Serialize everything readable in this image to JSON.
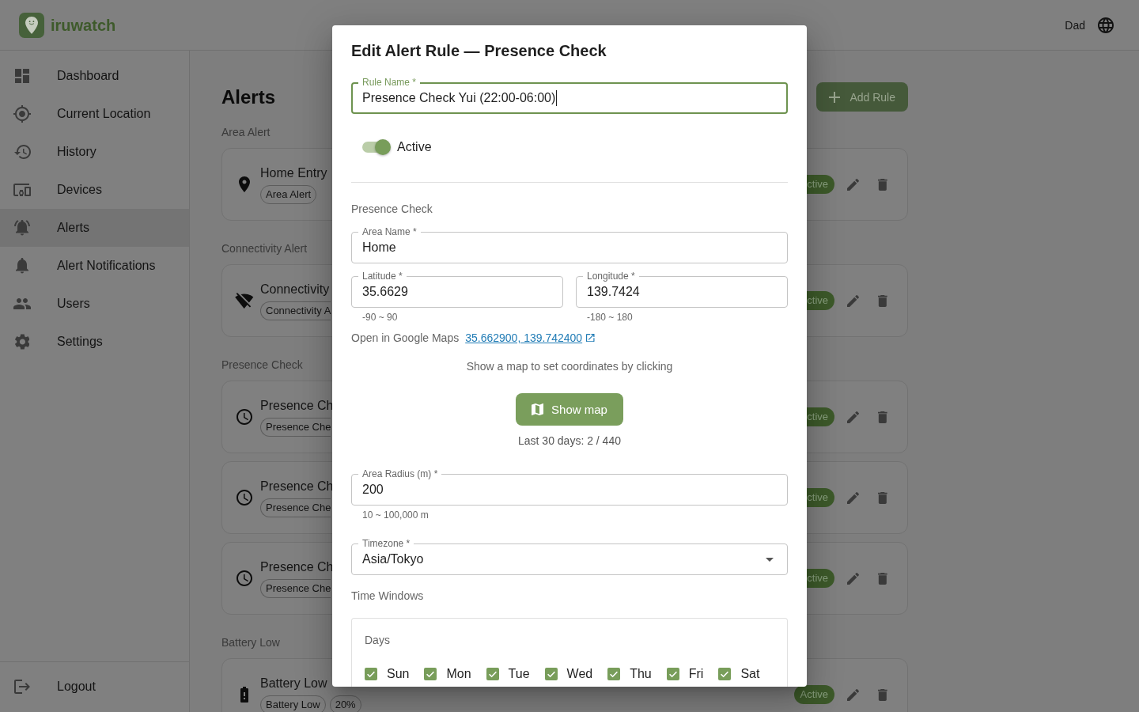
{
  "header": {
    "app_name": "iruwatch",
    "user": "Dad"
  },
  "sidebar": {
    "items": [
      {
        "label": "Dashboard",
        "selected": false
      },
      {
        "label": "Current Location",
        "selected": false
      },
      {
        "label": "History",
        "selected": false
      },
      {
        "label": "Devices",
        "selected": false
      },
      {
        "label": "Alerts",
        "selected": true
      },
      {
        "label": "Alert Notifications",
        "selected": false
      },
      {
        "label": "Users",
        "selected": false
      },
      {
        "label": "Settings",
        "selected": false
      }
    ],
    "logout": "Logout"
  },
  "page": {
    "title": "Alerts",
    "add_button": "Add Rule",
    "sections": [
      {
        "heading": "Area Alert",
        "rules": [
          {
            "title": "Home Entry",
            "tags": [
              {
                "label": "Area Alert",
                "clipped": false
              }
            ],
            "status": "ctive",
            "status_clipped": true
          }
        ]
      },
      {
        "heading": "Connectivity Alert",
        "rules": [
          {
            "title": "Connectivity",
            "tags": [
              {
                "label": "Connectivity A",
                "clipped": true
              }
            ],
            "status": "ctive",
            "status_clipped": true
          }
        ]
      },
      {
        "heading": "Presence Check",
        "rules": [
          {
            "title": "Presence Ch",
            "tags": [
              {
                "label": "Presence Che",
                "clipped": true
              }
            ],
            "status": "ctive",
            "status_clipped": true
          },
          {
            "title": "Presence Ch",
            "tags": [
              {
                "label": "Presence Che",
                "clipped": true
              }
            ],
            "status": "ctive",
            "status_clipped": true
          },
          {
            "title": "Presence Ch",
            "tags": [
              {
                "label": "Presence Che",
                "clipped": true
              }
            ],
            "status": "ctive",
            "status_clipped": true
          }
        ]
      },
      {
        "heading": "Battery Low",
        "rules": [
          {
            "title": "Battery Low",
            "tags": [
              {
                "label": "Battery Low",
                "clipped": false
              },
              {
                "label": "20%",
                "clipped": false
              }
            ],
            "status": "Active",
            "status_clipped": false
          }
        ]
      }
    ]
  },
  "dialog": {
    "title": "Edit Alert Rule — Presence Check",
    "rule_name": {
      "label": "Rule Name *",
      "value": "Presence Check Yui (22:00-06:00)",
      "focused": true
    },
    "active_switch": {
      "label": "Active",
      "on": true
    },
    "section": "Presence Check",
    "area_name": {
      "label": "Area Name *",
      "value": "Home"
    },
    "coordinates": [
      {
        "label": "Latitude *",
        "value": "35.6629",
        "helper": "-90 ~ 90"
      },
      {
        "label": "Longitude *",
        "value": "139.7424",
        "helper": "-180 ~ 180"
      }
    ],
    "maps": {
      "label": "Open in Google Maps",
      "link": "35.662900, 139.742400"
    },
    "map_hint": "Show a map to set coordinates by clicking",
    "map_button": "Show map",
    "stats": "Last 30 days: 2 / 440",
    "area_radius": {
      "label": "Area Radius (m) *",
      "value": "200",
      "helper": "10 ~ 100,000 m"
    },
    "timezone": {
      "label": "Timezone *",
      "value": "Asia/Tokyo"
    },
    "time_windows": {
      "heading": "Time Windows",
      "days_label": "Days",
      "days": [
        {
          "label": "Sun",
          "checked": true
        },
        {
          "label": "Mon",
          "checked": true
        },
        {
          "label": "Tue",
          "checked": true
        },
        {
          "label": "Wed",
          "checked": true
        },
        {
          "label": "Thu",
          "checked": true
        },
        {
          "label": "Fri",
          "checked": true
        },
        {
          "label": "Sat",
          "checked": true
        }
      ]
    }
  }
}
